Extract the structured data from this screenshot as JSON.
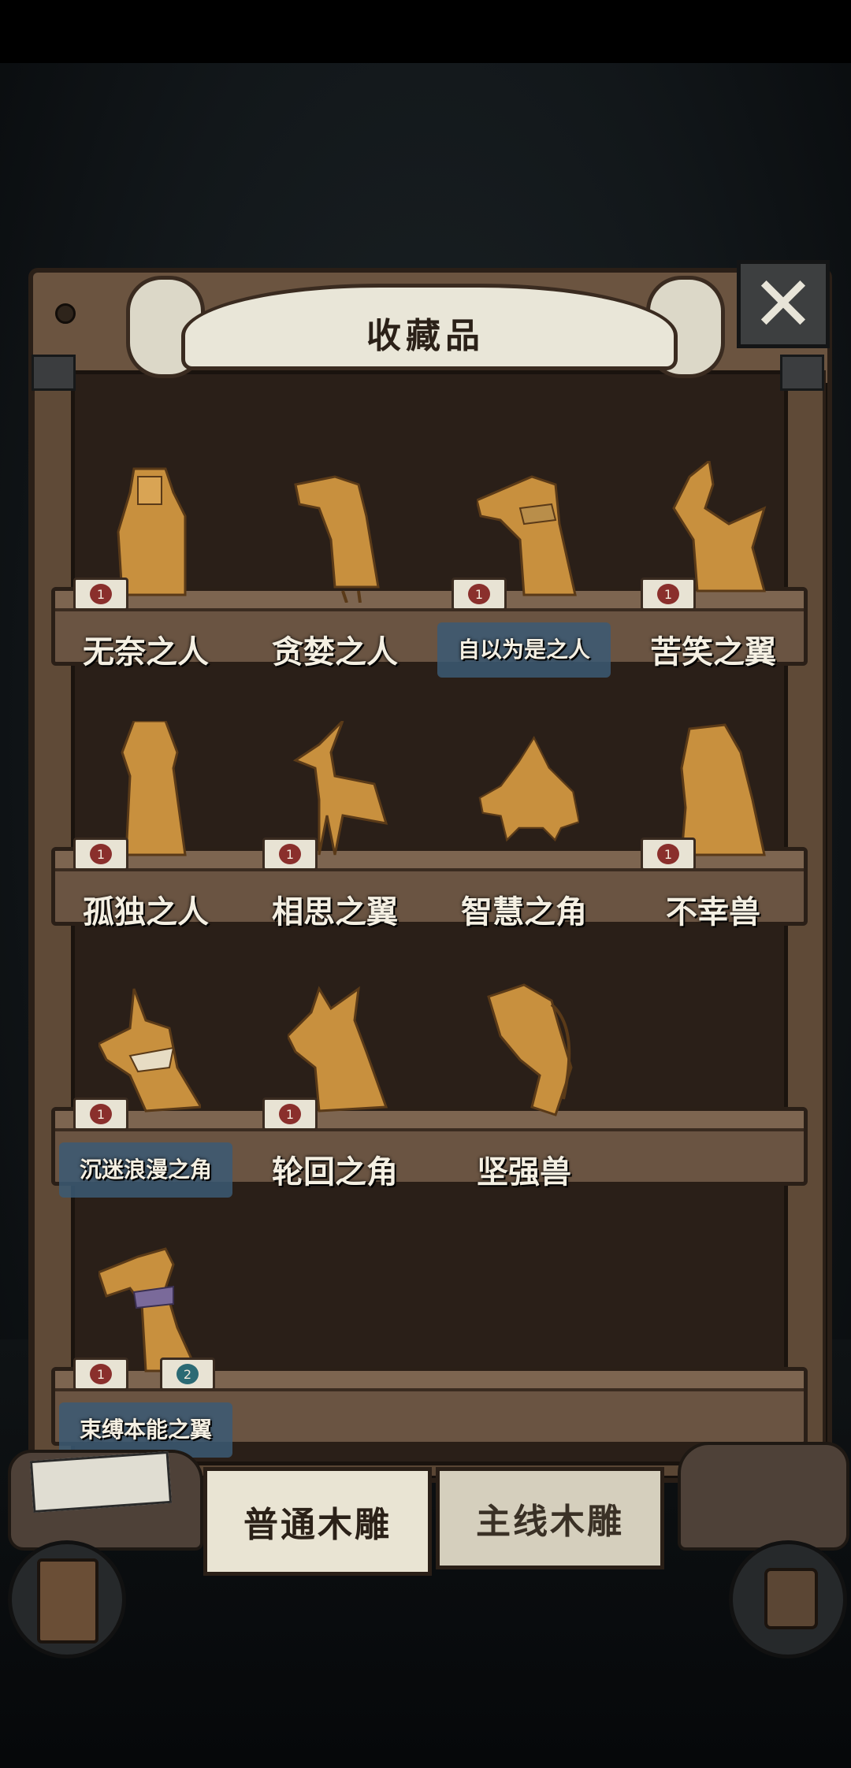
{
  "header": {
    "title": "收藏品"
  },
  "close_icon": "close-icon",
  "shelves": [
    {
      "items": [
        {
          "name": "无奈之人",
          "badge": "1",
          "highlight": false
        },
        {
          "name": "贪婪之人",
          "badge": "",
          "highlight": false
        },
        {
          "name": "自以为是之人",
          "badge": "1",
          "highlight": true
        },
        {
          "name": "苦笑之翼",
          "badge": "1",
          "highlight": false
        }
      ]
    },
    {
      "items": [
        {
          "name": "孤独之人",
          "badge": "1",
          "highlight": false
        },
        {
          "name": "相思之翼",
          "badge": "1",
          "highlight": false
        },
        {
          "name": "智慧之角",
          "badge": "",
          "highlight": false
        },
        {
          "name": "不幸兽",
          "badge": "1",
          "highlight": false
        }
      ]
    },
    {
      "items": [
        {
          "name": "沉迷浪漫之角",
          "badge": "1",
          "highlight": true
        },
        {
          "name": "轮回之角",
          "badge": "1",
          "highlight": false
        },
        {
          "name": "坚强兽",
          "badge": "",
          "highlight": false
        }
      ]
    },
    {
      "items": [
        {
          "name": "束缚本能之翼",
          "badge": "1",
          "badge2": "2",
          "highlight": true
        }
      ]
    }
  ],
  "tabs": {
    "normal": "普通木雕",
    "main": "主线木雕"
  },
  "colors": {
    "wood": "#5a4634",
    "paper": "#e9e4d3",
    "highlight": "#3b5b74",
    "badge": "#8a2f2c"
  }
}
